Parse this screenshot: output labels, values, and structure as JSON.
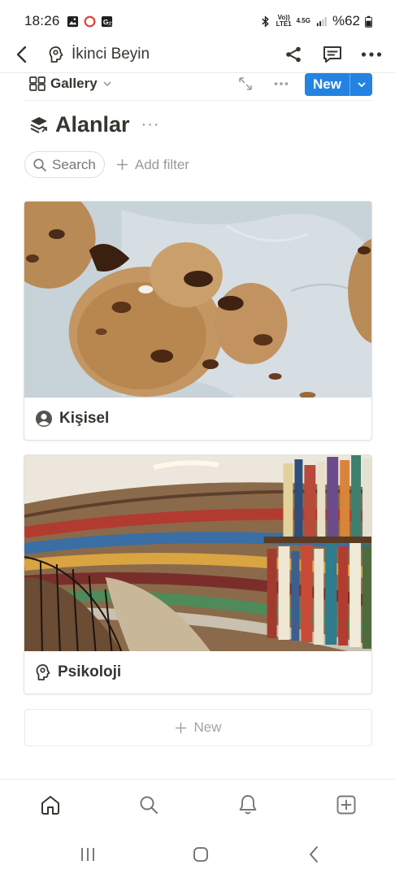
{
  "status_bar": {
    "time": "18:26",
    "network_top": "Vo))",
    "network_bottom": "LTE1",
    "network_gen": "4.5G",
    "battery": "%62"
  },
  "header": {
    "title": "İkinci Beyin"
  },
  "toolbar": {
    "view_label": "Gallery",
    "new_label": "New"
  },
  "database": {
    "title": "Alanlar",
    "more": "···"
  },
  "filters": {
    "search_label": "Search",
    "add_filter_label": "Add filter"
  },
  "cards": [
    {
      "title": "Kişisel",
      "icon": "person-circle-icon"
    },
    {
      "title": "Psikoloji",
      "icon": "head-brain-icon"
    }
  ],
  "new_row_label": "New",
  "bottom_nav": [
    "home-icon",
    "search-icon",
    "bell-icon",
    "add-square-icon"
  ],
  "colors": {
    "accent": "#2383e2",
    "text": "#37352f",
    "muted": "#9b9a97",
    "border": "#e3e2df"
  }
}
